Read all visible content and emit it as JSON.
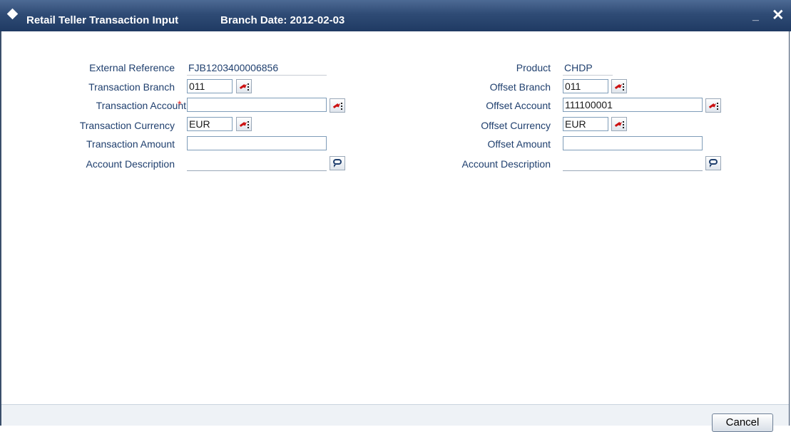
{
  "titlebar": {
    "title": "Retail Teller Transaction Input",
    "branch_date": "Branch Date: 2012-02-03",
    "minimize_glyph": "_",
    "close_glyph": "✕"
  },
  "left": {
    "external_reference": {
      "label": "External Reference",
      "value": "FJB1203400006856"
    },
    "transaction_branch": {
      "label": "Transaction Branch",
      "value": "011"
    },
    "transaction_account": {
      "label": "Transaction Account",
      "required_mark": "*",
      "value": ""
    },
    "transaction_currency": {
      "label": "Transaction Currency",
      "value": "EUR"
    },
    "transaction_amount": {
      "label": "Transaction Amount",
      "value": ""
    },
    "account_description": {
      "label": "Account Description",
      "value": ""
    }
  },
  "right": {
    "product": {
      "label": "Product",
      "value": "CHDP"
    },
    "offset_branch": {
      "label": "Offset Branch",
      "value": "011"
    },
    "offset_account": {
      "label": "Offset Account",
      "value": "111100001"
    },
    "offset_currency": {
      "label": "Offset Currency",
      "value": "EUR"
    },
    "offset_amount": {
      "label": "Offset Amount",
      "value": ""
    },
    "account_description": {
      "label": "Account Description",
      "value": ""
    }
  },
  "footer": {
    "cancel_label": "Cancel"
  },
  "colors": {
    "titlebar": "#2f4b75",
    "label_text": "#1f3f6e",
    "required": "#e02020",
    "lov_arrow": "#cc1111"
  },
  "icons": {
    "title": "diamond-icon",
    "lov": "list-of-values-icon",
    "description": "speech-bubble-icon"
  }
}
